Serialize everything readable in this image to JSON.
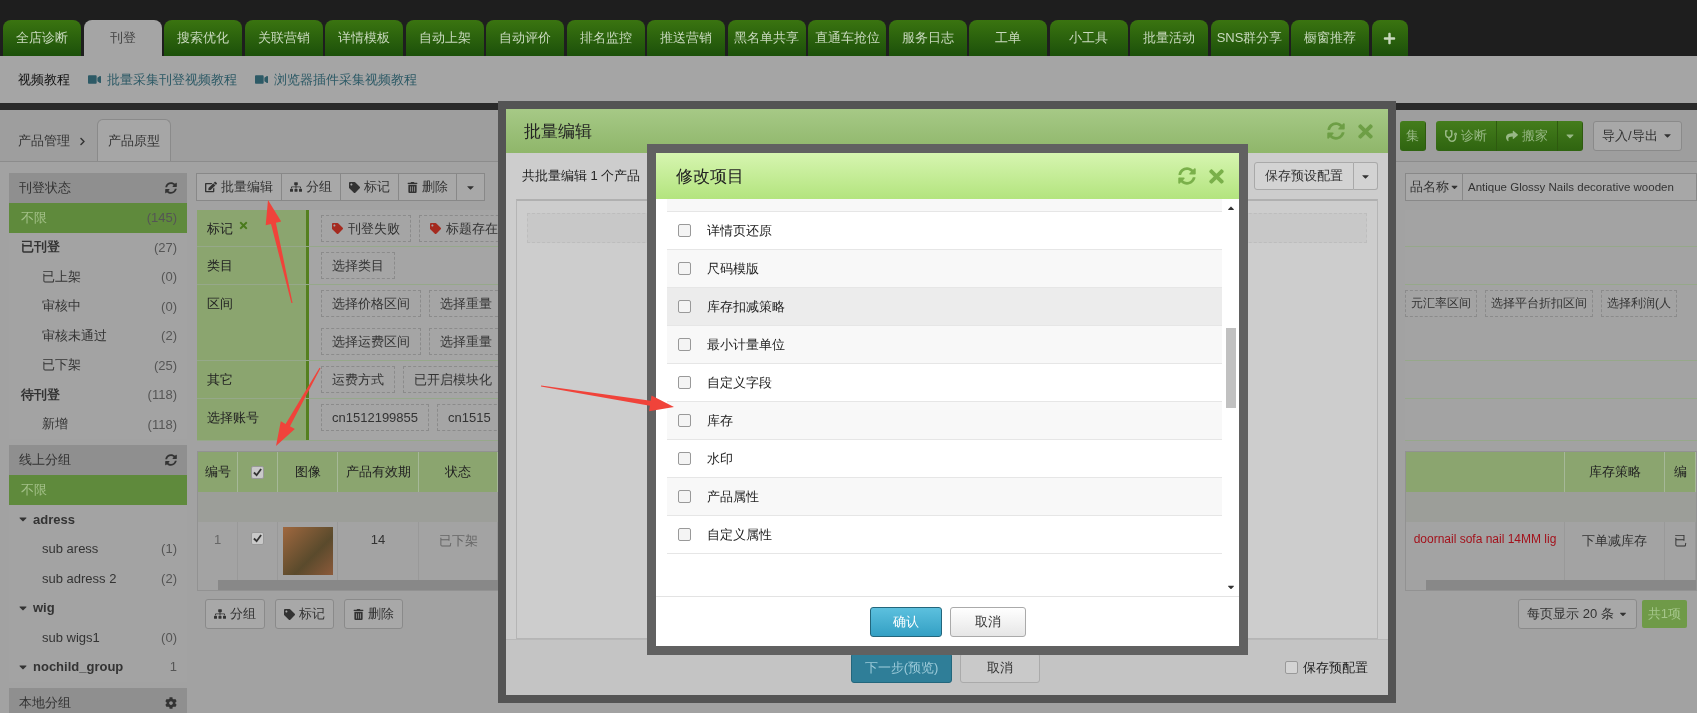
{
  "nav_tabs": [
    {
      "label": "全店诊断",
      "selected": false
    },
    {
      "label": "刊登",
      "selected": true
    },
    {
      "label": "搜索优化",
      "selected": false
    },
    {
      "label": "关联营销",
      "selected": false
    },
    {
      "label": "详情模板",
      "selected": false
    },
    {
      "label": "自动上架",
      "selected": false
    },
    {
      "label": "自动评价",
      "selected": false
    },
    {
      "label": "排名监控",
      "selected": false
    },
    {
      "label": "推送营销",
      "selected": false
    },
    {
      "label": "黑名单共享",
      "selected": false
    },
    {
      "label": "直通车抢位",
      "selected": false
    },
    {
      "label": "服务日志",
      "selected": false
    },
    {
      "label": "工单",
      "selected": false
    },
    {
      "label": "小工具",
      "selected": false
    },
    {
      "label": "批量活动",
      "selected": false
    },
    {
      "label": "SNS群分享",
      "selected": false
    },
    {
      "label": "橱窗推荐",
      "selected": false
    }
  ],
  "sub_bar": {
    "title": "视频教程",
    "links": [
      "批量采集刊登视频教程",
      "浏览器插件采集视频教程"
    ]
  },
  "breadcrumb": [
    {
      "label": "产品管理",
      "selected": false
    },
    {
      "label": "产品原型",
      "selected": true
    }
  ],
  "actions": [
    {
      "label": "集",
      "kind": "plain"
    },
    {
      "label": "诊断",
      "kind": "diagnose"
    },
    {
      "label": "搬家",
      "kind": "move"
    },
    {
      "kind": "caret"
    },
    {
      "label": "导入/导出",
      "kind": "dropdown"
    }
  ],
  "sidebar": [
    {
      "title": "刊登状态",
      "kind": "refresh",
      "items": [
        {
          "label": "不限",
          "count": "(145)",
          "selected": true
        },
        {
          "label": "已刊登",
          "count": "(27)",
          "selected": false,
          "children": [
            {
              "label": "已上架",
              "count": "(0)",
              "selected": false
            },
            {
              "label": "审核中",
              "count": "(0)",
              "selected": false
            },
            {
              "label": "审核未通过",
              "count": "(2)",
              "selected": false
            },
            {
              "label": "已下架",
              "count": "(25)",
              "selected": false
            }
          ]
        },
        {
          "label": "待刊登",
          "count": "(118)",
          "selected": false,
          "children": [
            {
              "label": "新增",
              "count": "(118)",
              "selected": false
            }
          ]
        }
      ]
    },
    {
      "title": "线上分组",
      "kind": "refresh",
      "items": [
        {
          "label": "不限",
          "selected": true
        },
        {
          "label": "adress",
          "selected": false,
          "expanded": true,
          "children": [
            {
              "label": "sub aress",
              "count": "(1)",
              "selected": false
            },
            {
              "label": "sub adress 2",
              "count": "(2)",
              "selected": false
            }
          ]
        },
        {
          "label": "wig",
          "selected": false,
          "expanded": true,
          "children": [
            {
              "label": "sub wigs1",
              "count": "(0)",
              "selected": false
            }
          ]
        },
        {
          "label": "nochild_group",
          "count": "1",
          "selected": false,
          "expanded": true
        }
      ]
    },
    {
      "title": "本地分组",
      "kind": "settings"
    }
  ],
  "toolbar": [
    {
      "label": "批量编辑",
      "kind": "edit"
    },
    {
      "label": "分组",
      "kind": "group"
    },
    {
      "label": "标记",
      "kind": "tag"
    },
    {
      "label": "删除",
      "kind": "delete"
    },
    {
      "kind": "caret"
    }
  ],
  "search": {
    "field": "品名称",
    "value": "Antique Glossy Nails decorative wooden"
  },
  "filters": [
    {
      "label": "标记",
      "removable": true,
      "lines": [
        [
          {
            "label": "刊登失败",
            "kind": "tag"
          },
          {
            "label": "标题存在",
            "kind": "tag"
          }
        ]
      ]
    },
    {
      "label": "类目",
      "removable": false,
      "lines": [
        [
          {
            "label": "选择类目",
            "kind": "plain"
          }
        ]
      ]
    },
    {
      "label": "区间",
      "removable": false,
      "lines": [
        [
          {
            "label": "选择价格区间",
            "kind": "plain"
          },
          {
            "label": "选择重量",
            "kind": "plain"
          }
        ],
        [
          {
            "label": "选择运费区间",
            "kind": "plain"
          },
          {
            "label": "选择重量",
            "kind": "plain"
          }
        ]
      ],
      "chips_right": [
        "元汇率区间",
        "选择平台折扣区间",
        "选择利润(人"
      ]
    },
    {
      "label": "其它",
      "removable": false,
      "lines": [
        [
          {
            "label": "运费方式",
            "kind": "plain"
          },
          {
            "label": "已开启模块化",
            "kind": "plain"
          }
        ]
      ]
    },
    {
      "label": "选择账号",
      "removable": false,
      "lines": [
        [
          {
            "label": "cn1512199855",
            "kind": "plain"
          },
          {
            "label": "cn1515",
            "kind": "plain"
          }
        ]
      ]
    }
  ],
  "table": {
    "columns": [
      {
        "label": "编号",
        "kind": "text"
      },
      {
        "kind": "checkbox",
        "checked": true
      },
      {
        "label": "图像",
        "kind": "text"
      },
      {
        "label": "产品有效期",
        "kind": "text"
      },
      {
        "label": "状态",
        "kind": "text"
      }
    ],
    "right_columns": [
      "库存策略",
      "编"
    ],
    "rows": [
      {
        "number": "1",
        "checked": true,
        "expiry": "14",
        "status": "已下架",
        "title": "doornail sofa nail 14MM lig",
        "stock_policy": "下单减库存",
        "column_8": "已"
      }
    ]
  },
  "bottom_buttons": [
    {
      "label": "分组",
      "kind": "group"
    },
    {
      "label": "标记",
      "kind": "tag"
    },
    {
      "label": "删除",
      "kind": "delete"
    }
  ],
  "pagination": {
    "page_size": "每页显示 20 条",
    "total": "共1项"
  },
  "batch_dialog": {
    "title": "批量编辑",
    "summary": "共批量编辑 1 个产品",
    "preset_button": "保存预设配置",
    "next_button": "下一步(预览)",
    "cancel_button": "取消",
    "save_preset": {
      "label": "保存预配置",
      "checked": false
    }
  },
  "items_dialog": {
    "title": "修改项目",
    "items": [
      {
        "label": "详情页还原",
        "checked": false,
        "highlighted": false
      },
      {
        "label": "尺码模版",
        "checked": false,
        "highlighted": false
      },
      {
        "label": "库存扣减策略",
        "checked": false,
        "highlighted": true
      },
      {
        "label": "最小计量单位",
        "checked": false,
        "highlighted": false
      },
      {
        "label": "自定义字段",
        "checked": false,
        "highlighted": false
      },
      {
        "label": "库存",
        "checked": false,
        "highlighted": false
      },
      {
        "label": "水印",
        "checked": false,
        "highlighted": false
      },
      {
        "label": "产品属性",
        "checked": false,
        "highlighted": false
      },
      {
        "label": "自定义属性",
        "checked": false,
        "highlighted": false
      }
    ],
    "confirm_button": "确认",
    "cancel_button": "取消"
  }
}
